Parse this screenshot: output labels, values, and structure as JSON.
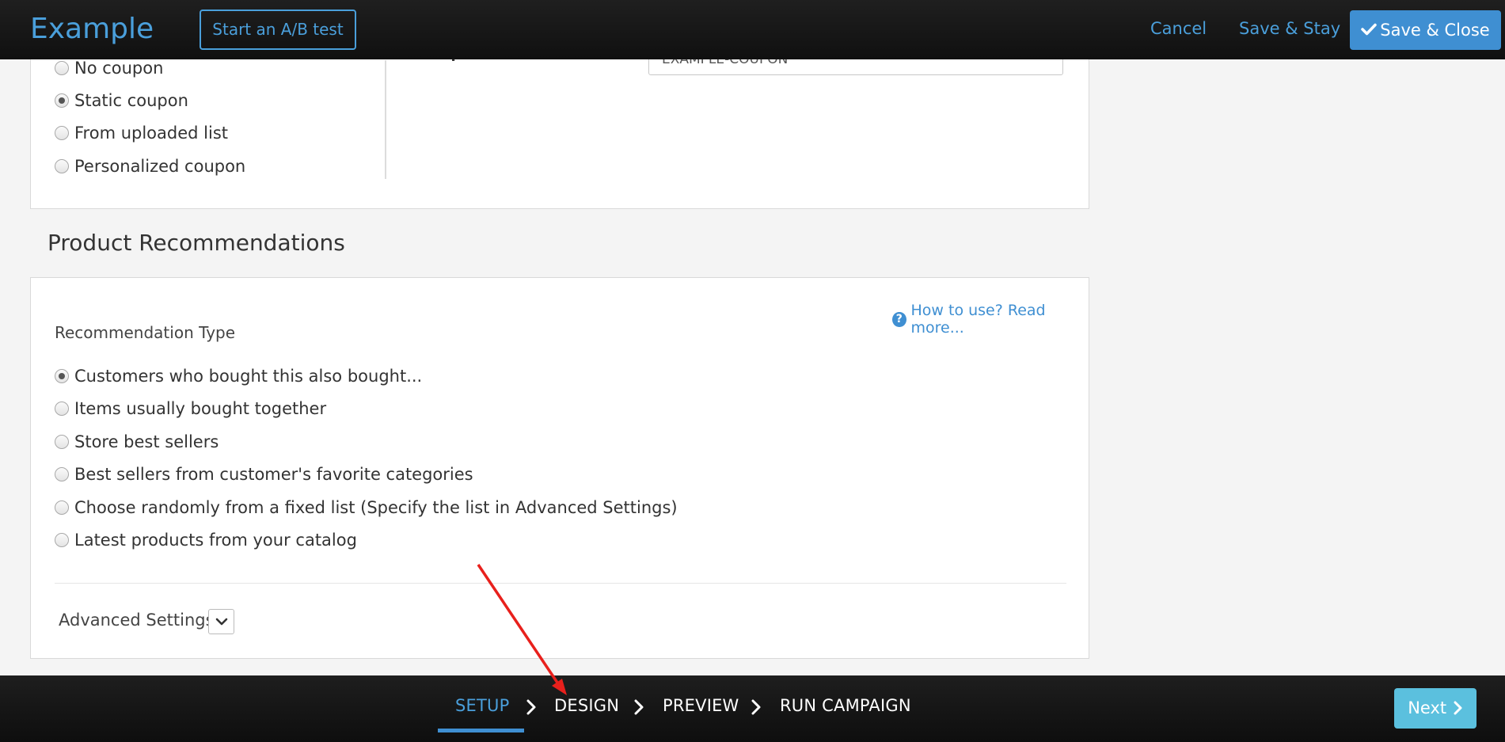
{
  "header": {
    "brand": "Example",
    "ab_test_label": "Start an A/B test",
    "cancel_label": "Cancel",
    "save_stay_label": "Save & Stay",
    "save_close_label": "Save & Close"
  },
  "coupon": {
    "field_value": "EXAMPLE-COUPON",
    "options": [
      {
        "label": "No coupon",
        "checked": false
      },
      {
        "label": "Static coupon",
        "checked": true
      },
      {
        "label": "From uploaded list",
        "checked": false
      },
      {
        "label": "Personalized coupon",
        "checked": false
      }
    ]
  },
  "recommendations": {
    "section_title": "Product Recommendations",
    "help_link": "How to use? Read more...",
    "type_label": "Recommendation Type",
    "options": [
      {
        "label": "Customers who bought this also bought...",
        "checked": true
      },
      {
        "label": "Items usually bought together",
        "checked": false
      },
      {
        "label": "Store best sellers",
        "checked": false
      },
      {
        "label": "Best sellers from customer's favorite categories",
        "checked": false
      },
      {
        "label": "Choose randomly from a fixed list (Specify the list in Advanced Settings)",
        "checked": false
      },
      {
        "label": "Latest products from your catalog",
        "checked": false
      }
    ],
    "advanced_label": "Advanced Settings"
  },
  "steps": [
    {
      "label": "SETUP",
      "active": true
    },
    {
      "label": "DESIGN",
      "active": false
    },
    {
      "label": "PREVIEW",
      "active": false
    },
    {
      "label": "RUN CAMPAIGN",
      "active": false
    }
  ],
  "next_label": "Next",
  "colors": {
    "accent": "#4a9fdb",
    "primary_button": "#3f8fd2",
    "next_button": "#5bc0de",
    "annotation_arrow": "#e8201c"
  },
  "icons": {
    "save_close": "check-icon",
    "help": "question-circle-icon",
    "advanced": "chevron-down-icon",
    "step_separator": "chevron-right-icon",
    "next": "chevron-right-icon"
  }
}
